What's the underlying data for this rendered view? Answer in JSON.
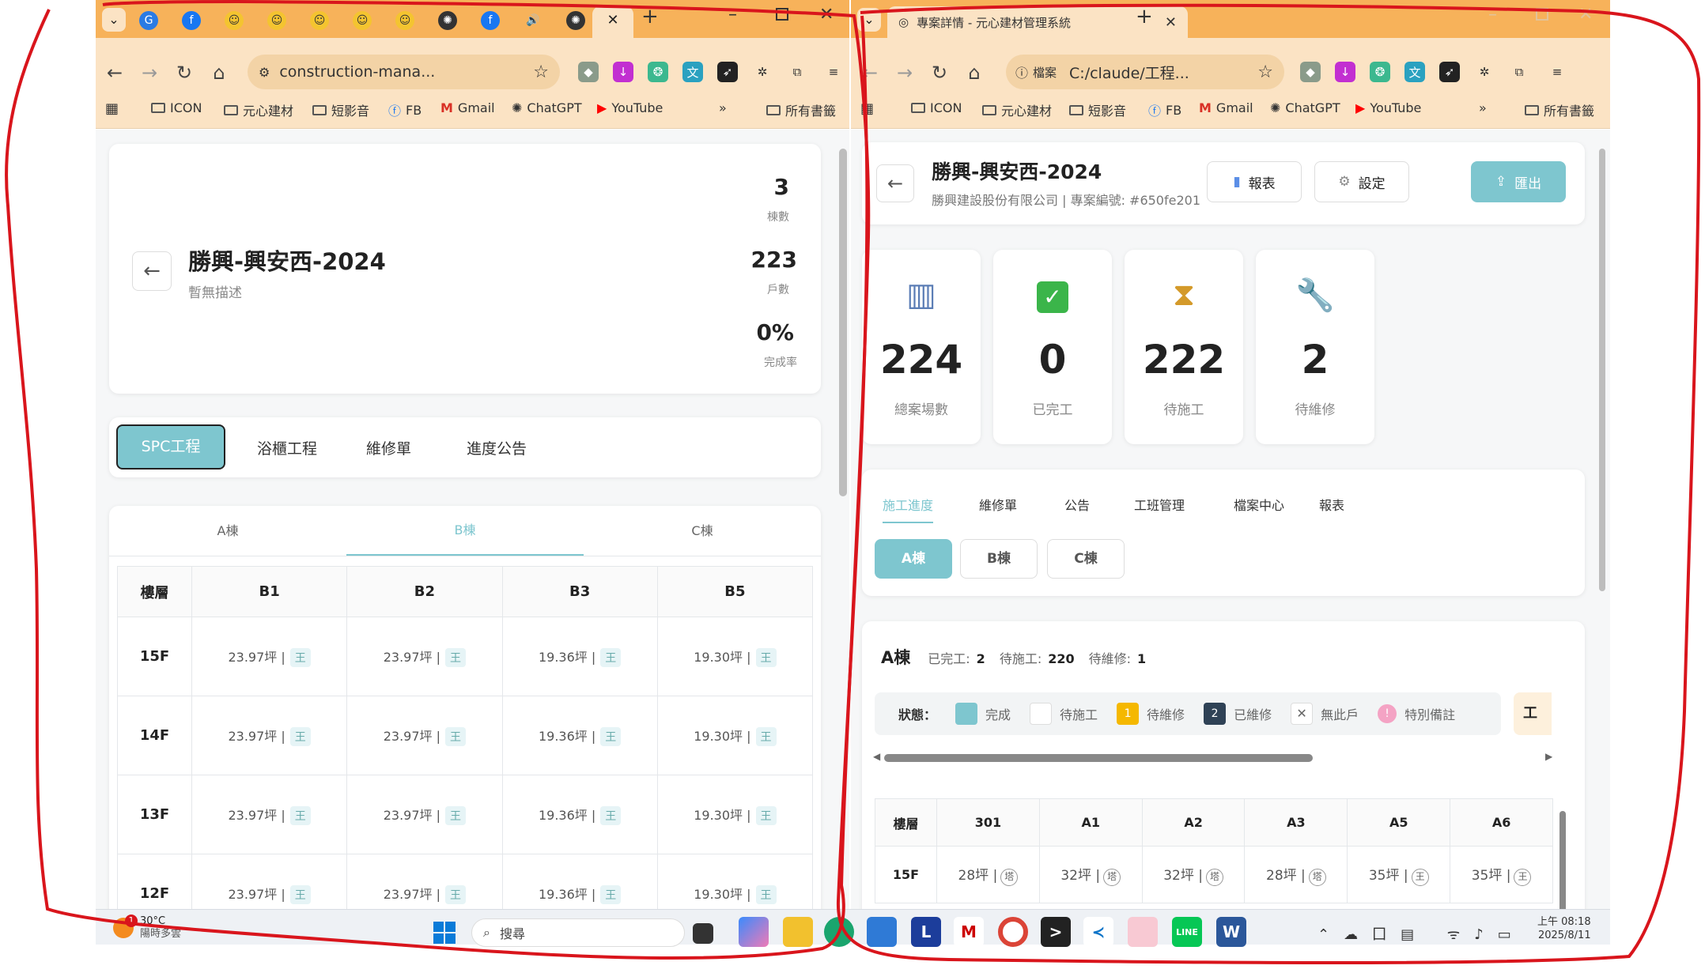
{
  "left": {
    "tab_bar": {
      "active_tab_label": "",
      "new_tab": "+"
    },
    "address": "construction-mana...",
    "bookmarks": [
      "ICON",
      "元心建材",
      "短影音",
      "FB",
      "Gmail",
      "ChatGPT",
      "YouTube"
    ],
    "bookmarks_all": "所有書籤",
    "project": {
      "title": "勝興-興安西-2024",
      "desc": "暫無描述",
      "stats": [
        {
          "value": "3",
          "label": "棟數"
        },
        {
          "value": "223",
          "label": "戶數"
        },
        {
          "value": "0%",
          "label": "完成率"
        }
      ]
    },
    "tabs": [
      "SPC工程",
      "浴櫃工程",
      "維修單",
      "進度公告"
    ],
    "buildings": [
      "A棟",
      "B棟",
      "C棟"
    ],
    "table": {
      "header": [
        "樓層",
        "B1",
        "B2",
        "B3",
        "B5"
      ],
      "rows": [
        {
          "floor": "15F",
          "cells": [
            "23.97坪 |",
            "23.97坪 |",
            "19.36坪 |",
            "19.30坪 |"
          ]
        },
        {
          "floor": "14F",
          "cells": [
            "23.97坪 |",
            "23.97坪 |",
            "19.36坪 |",
            "19.30坪 |"
          ]
        },
        {
          "floor": "13F",
          "cells": [
            "23.97坪 |",
            "23.97坪 |",
            "19.36坪 |",
            "19.30坪 |"
          ]
        },
        {
          "floor": "12F",
          "cells": [
            "23.97坪 |",
            "23.97坪 |",
            "19.36坪 |",
            "19.30坪 |"
          ]
        }
      ],
      "tag": "王"
    }
  },
  "right": {
    "tab_title": "專案詳情 - 元心建材管理系統",
    "address_prefix": "檔案",
    "address": "C:/claude/工程...",
    "bookmarks": [
      "ICON",
      "元心建材",
      "短影音",
      "FB",
      "Gmail",
      "ChatGPT",
      "YouTube"
    ],
    "bookmarks_all": "所有書籤",
    "project": {
      "title": "勝興-興安西-2024",
      "subtitle": "勝興建設股份有限公司 | 專案編號: #650fe201"
    },
    "buttons": {
      "report": "報表",
      "settings": "設定",
      "export": "匯出"
    },
    "stats": [
      {
        "value": "224",
        "label": "總案場數",
        "icon": "🏢"
      },
      {
        "value": "0",
        "label": "已完工",
        "icon": "✅"
      },
      {
        "value": "222",
        "label": "待施工",
        "icon": "⏳"
      },
      {
        "value": "2",
        "label": "待維修",
        "icon": "🔧"
      }
    ],
    "tabs": [
      "施工進度",
      "維修單",
      "公告",
      "工班管理",
      "檔案中心",
      "報表"
    ],
    "buildings": [
      "A棟",
      "B棟",
      "C棟"
    ],
    "summary": {
      "name": "A棟",
      "done_label": "已完工:",
      "done": "2",
      "pending_label": "待施工:",
      "pending": "220",
      "repair_label": "待維修:",
      "repair": "1"
    },
    "legend": {
      "title": "狀態：",
      "items": [
        "完成",
        "待施工",
        "待維修",
        "已維修",
        "無此戶",
        "特別備註"
      ],
      "badge1": "1",
      "badge2": "2",
      "cut": "工"
    },
    "table": {
      "header": [
        "樓層",
        "301",
        "A1",
        "A2",
        "A3",
        "A5",
        "A6"
      ],
      "row": {
        "floor": "15F",
        "cells": [
          "28坪 |",
          "32坪 |",
          "32坪 |",
          "28坪 |",
          "35坪 |",
          "35坪 |"
        ],
        "tags": [
          "塔",
          "塔",
          "塔",
          "塔",
          "王",
          "王"
        ]
      }
    }
  },
  "taskbar": {
    "temp": "30°C",
    "weather": "陽時多雲",
    "badge": "1",
    "search": "搜尋",
    "time": "上午 08:18",
    "date": "2025/8/11"
  },
  "colors": {
    "accent": "#7ec6cf",
    "tabstrip": "#f7b25a",
    "toolbar": "#fbe3c4",
    "annotation": "#d9151c"
  }
}
